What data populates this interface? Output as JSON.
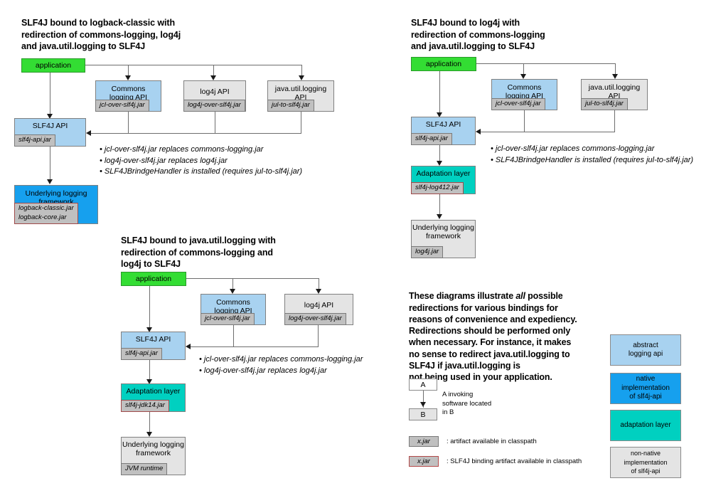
{
  "diagrams": [
    {
      "id": "logback",
      "title": "SLF4J bound to logback-classic with\nredirection of commons-logging, log4j\nand java.util.logging to SLF4J",
      "application": "application",
      "nodes": {
        "commons": {
          "label": "Commons\nlogging API",
          "jar": "jcl-over-slf4j.jar"
        },
        "log4j": {
          "label": "log4j API",
          "jar": "log4j-over-slf4j.jar"
        },
        "jul": {
          "label": "java.util.logging\nAPI",
          "jar": "jul-to-slf4j.jar"
        },
        "slf4japi": {
          "label": "SLF4J API",
          "jar": "slf4j-api.jar"
        },
        "underlying": {
          "label": "Underlying logging\nframework",
          "jar": "logback-classic.jar\nlogback-core.jar"
        }
      },
      "bullets": [
        "jcl-over-slf4j.jar replaces commons-logging.jar",
        "log4j-over-slf4j.jar replaces log4j.jar",
        "SLF4JBrindgeHandler is installed (requires jul-to-slf4j.jar)"
      ]
    },
    {
      "id": "log4j",
      "title": "SLF4J bound to log4j with\nredirection of commons-logging\nand java.util.logging to SLF4J",
      "application": "application",
      "nodes": {
        "commons": {
          "label": "Commons\nlogging API",
          "jar": "jcl-over-slf4j.jar"
        },
        "jul": {
          "label": "java.util.logging\nAPI",
          "jar": "jul-to-slf4j.jar"
        },
        "slf4japi": {
          "label": "SLF4J API",
          "jar": "slf4j-api.jar"
        },
        "adaptation": {
          "label": "Adaptation layer",
          "jar": "slf4j-log412.jar"
        },
        "underlying": {
          "label": "Underlying\nlogging\nframework",
          "jar": "log4j.jar"
        }
      },
      "bullets": [
        "jcl-over-slf4j.jar replaces commons-logging.jar",
        "SLF4JBrindgeHandler is installed (requires jul-to-slf4j.jar)"
      ]
    },
    {
      "id": "jul",
      "title": "SLF4J bound to java.util.logging with\nredirection of commons-logging and\nlog4j to SLF4J",
      "application": "application",
      "nodes": {
        "commons": {
          "label": "Commons\nlogging API",
          "jar": "jcl-over-slf4j.jar"
        },
        "log4j": {
          "label": "log4j API",
          "jar": "log4j-over-slf4j.jar"
        },
        "slf4japi": {
          "label": "SLF4J API",
          "jar": "slf4j-api.jar"
        },
        "adaptation": {
          "label": "Adaptation layer",
          "jar": "slf4j-jdk14.jar"
        },
        "underlying": {
          "label": "Underlying\nlogging\nframework",
          "jar": "JVM runtime"
        }
      },
      "bullets": [
        "jcl-over-slf4j.jar replaces commons-logging.jar",
        "log4j-over-slf4j.jar replaces log4j.jar"
      ]
    }
  ],
  "note": {
    "text_before": "These diagrams illustrate ",
    "emphasis": "all",
    "text_after": " possible\nredirections for various bindings for\nreasons of convenience and expediency.\nRedirections should be performed only\nwhen necessary. For instance, it makes\nno sense to redirect java.util.logging to\nSLF4J if java.util.logging is\nnot being used in your application."
  },
  "legend": {
    "invocation": {
      "box_a": "A",
      "box_b": "B",
      "caption": "A invoking\nsoftware located\nin B"
    },
    "artifact": {
      "chip": "x.jar",
      "caption": ": artifact available in classpath"
    },
    "binding_artifact": {
      "chip": "x.jar",
      "caption": ": SLF4J binding artifact available in classpath"
    },
    "colors": [
      {
        "label": "abstract\nlogging api",
        "color": "#a8d2f0"
      },
      {
        "label": "native implementation\nof slf4j-api",
        "color": "#16a0ee"
      },
      {
        "label": "adaptation layer",
        "color": "#00d0c0"
      },
      {
        "label": "non-native implementation\nof slf4j-api",
        "color": "#e4e4e4"
      }
    ]
  },
  "palette": {
    "application": "#33dd33",
    "abstract_api": "#a8d2f0",
    "native_impl": "#16a0ee",
    "adaptation": "#00d0c0",
    "non_native": "#e4e4e4",
    "jar_chip": "#c0c0c0",
    "binding_border": "#a04a4a",
    "connector": "#6e6e6e"
  }
}
